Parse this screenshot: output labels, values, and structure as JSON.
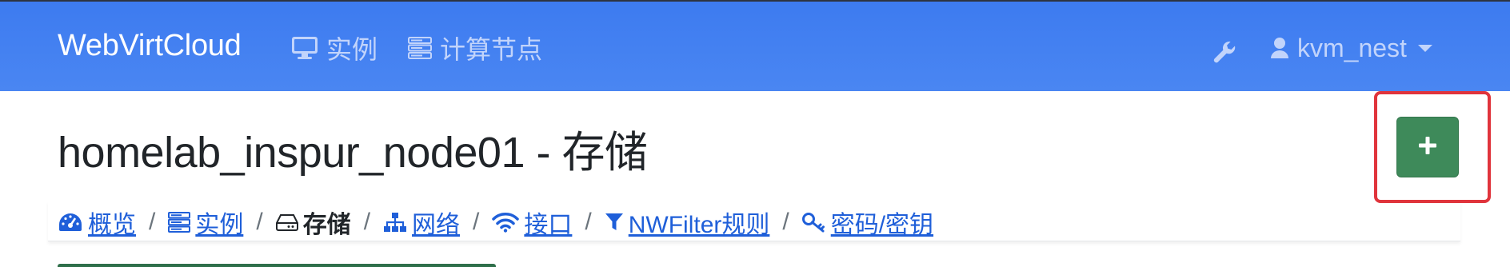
{
  "navbar": {
    "brand": "WebVirtCloud",
    "items": [
      {
        "label": "实例",
        "icon": "desktop-icon"
      },
      {
        "label": "计算节点",
        "icon": "server-icon"
      }
    ],
    "tools_icon": "wrench-icon",
    "user": {
      "label": "kvm_nest",
      "icon": "user-icon"
    }
  },
  "page": {
    "title": "homelab_inspur_node01 - 存储",
    "add_button": {
      "label": "+",
      "color": "#3e8a5a"
    },
    "highlight_color": "#e0343c"
  },
  "crumbs": [
    {
      "label": "概览",
      "icon": "dashboard-icon",
      "active": false
    },
    {
      "label": "实例",
      "icon": "server-icon",
      "active": false
    },
    {
      "label": "存储",
      "icon": "hdd-icon",
      "active": true
    },
    {
      "label": "网络",
      "icon": "sitemap-icon",
      "active": false
    },
    {
      "label": "接口",
      "icon": "wifi-icon",
      "active": false
    },
    {
      "label": "NWFilter规则",
      "icon": "filter-icon",
      "active": false
    },
    {
      "label": "密码/密钥",
      "icon": "key-icon",
      "active": false
    }
  ],
  "separator": "/"
}
